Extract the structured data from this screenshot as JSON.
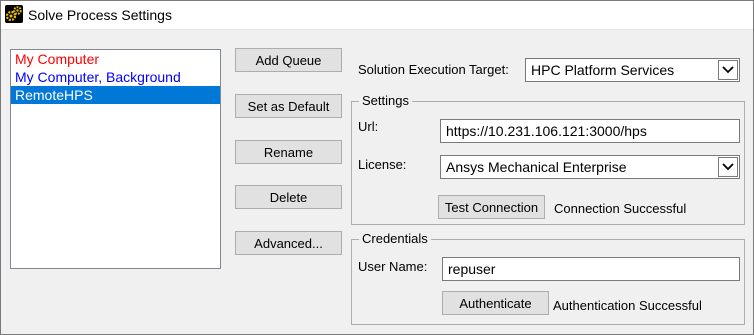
{
  "window": {
    "title": "Solve Process Settings"
  },
  "queues": {
    "items": [
      {
        "label": "My Computer",
        "color": "#ff0000",
        "selected": false
      },
      {
        "label": "My Computer, Background",
        "color": "#0000ff",
        "selected": false
      },
      {
        "label": "RemoteHPS",
        "color": "#ffffff",
        "selected": true
      }
    ],
    "selected_bg": "#0078d7"
  },
  "buttons": {
    "add_queue": "Add Queue",
    "set_default": "Set as Default",
    "rename": "Rename",
    "delete": "Delete",
    "advanced": "Advanced..."
  },
  "target": {
    "label": "Solution Execution Target:",
    "value": "HPC Platform Services"
  },
  "settings": {
    "group_label": "Settings",
    "url_label": "Url:",
    "url_value": "https://10.231.106.121:3000/hps",
    "license_label": "License:",
    "license_value": "Ansys Mechanical Enterprise",
    "test_button": "Test Connection",
    "test_status": "Connection Successful"
  },
  "credentials": {
    "group_label": "Credentials",
    "username_label": "User Name:",
    "username_value": "repuser",
    "auth_button": "Authenticate",
    "auth_status": "Authentication Successful"
  },
  "icons": {
    "app": "gears-icon",
    "dropdown": "chevron-down-icon"
  }
}
